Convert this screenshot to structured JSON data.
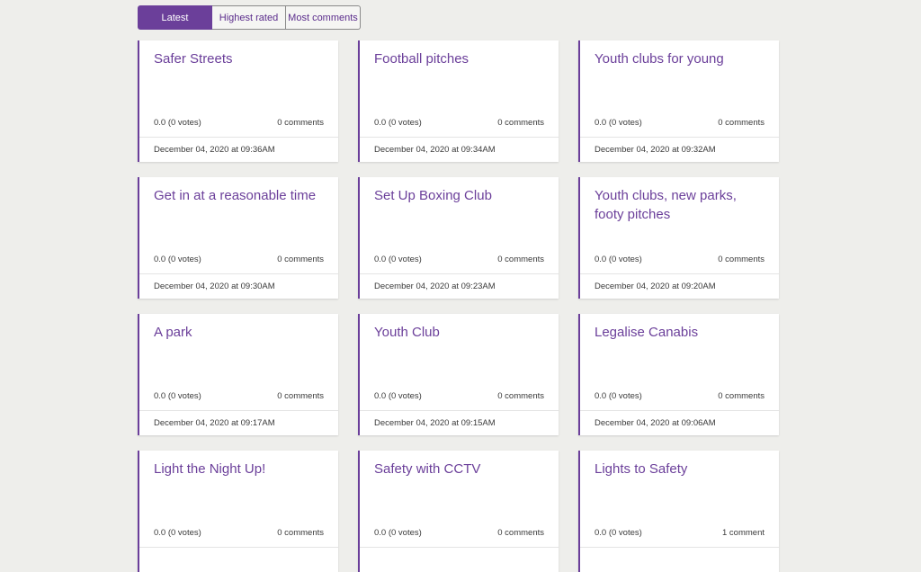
{
  "tabs": {
    "latest": "Latest",
    "highest_rated": "Highest rated",
    "most_comments": "Most comments",
    "active": "latest"
  },
  "colors": {
    "accent": "#6b3f9a",
    "background": "#eeeeeb",
    "card": "#ffffff"
  },
  "ideas": [
    {
      "title": "Safer Streets",
      "rating": "0.0 (0 votes)",
      "comments": "0 comments",
      "date": "December 04, 2020 at 09:36AM"
    },
    {
      "title": "Football pitches",
      "rating": "0.0 (0 votes)",
      "comments": "0 comments",
      "date": "December 04, 2020 at 09:34AM"
    },
    {
      "title": "Youth clubs for young",
      "rating": "0.0 (0 votes)",
      "comments": "0 comments",
      "date": "December 04, 2020 at 09:32AM"
    },
    {
      "title": "Get in at a reasonable time",
      "rating": "0.0 (0 votes)",
      "comments": "0 comments",
      "date": "December 04, 2020 at 09:30AM"
    },
    {
      "title": "Set Up Boxing Club",
      "rating": "0.0 (0 votes)",
      "comments": "0 comments",
      "date": "December 04, 2020 at 09:23AM"
    },
    {
      "title": "Youth clubs, new parks, footy pitches",
      "rating": "0.0 (0 votes)",
      "comments": "0 comments",
      "date": "December 04, 2020 at 09:20AM"
    },
    {
      "title": "A park",
      "rating": "0.0 (0 votes)",
      "comments": "0 comments",
      "date": "December 04, 2020 at 09:17AM"
    },
    {
      "title": "Youth Club",
      "rating": "0.0 (0 votes)",
      "comments": "0 comments",
      "date": "December 04, 2020 at 09:15AM"
    },
    {
      "title": "Legalise Canabis",
      "rating": "0.0 (0 votes)",
      "comments": "0 comments",
      "date": "December 04, 2020 at 09:06AM"
    },
    {
      "title": "Light the Night Up!",
      "rating": "0.0 (0 votes)",
      "comments": "0 comments",
      "date": ""
    },
    {
      "title": "Safety with CCTV",
      "rating": "0.0 (0 votes)",
      "comments": "0 comments",
      "date": ""
    },
    {
      "title": "Lights to Safety",
      "rating": "0.0 (0 votes)",
      "comments": "1 comment",
      "date": ""
    }
  ]
}
